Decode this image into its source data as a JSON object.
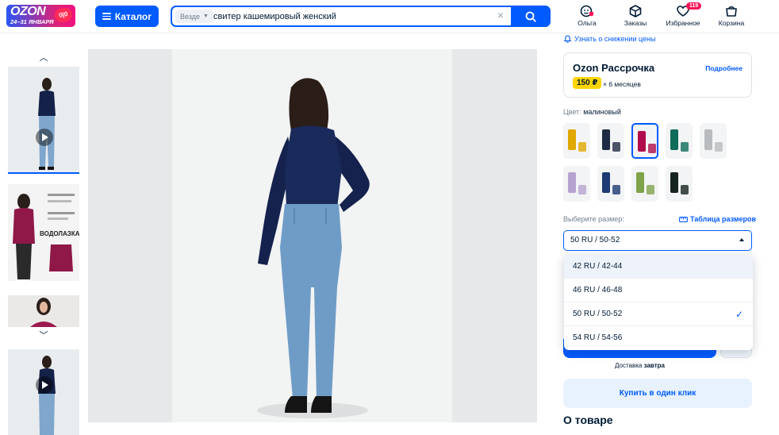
{
  "header": {
    "logo_text": "OZON",
    "logo_dates": "24–31 ЯНВАРЯ",
    "logo_badge": "0|0",
    "catalog_label": "Каталог",
    "search_scope": "Везде",
    "search_value": "свитер кашемировый женский",
    "nav": [
      {
        "label": "Ольга",
        "icon": "user-icon"
      },
      {
        "label": "Заказы",
        "icon": "box-icon"
      },
      {
        "label": "Избранное",
        "icon": "heart-icon",
        "badge": "119"
      },
      {
        "label": "Корзина",
        "icon": "cart-icon"
      }
    ]
  },
  "product": {
    "price_alert": "Узнать о снижении цены",
    "installment": {
      "title": "Ozon Рассрочка",
      "more": "Подробнее",
      "price": "150 ₽",
      "period": "× 6 месяцев"
    },
    "color_label": "Цвет:",
    "color_value": "малиновый",
    "colors": [
      "#e0a800",
      "#1f2a44",
      "#b00c4c",
      "#0f6b5a",
      "#b9bcbf",
      "#b7a2cf",
      "#1d3a72",
      "#7fa34a",
      "#16241f"
    ],
    "size_label": "Выберите размер:",
    "size_table": "Таблица размеров",
    "selected_size": "50 RU / 50-52",
    "size_options": [
      {
        "label": "42 RU / 42-44"
      },
      {
        "label": "46 RU / 46-48"
      },
      {
        "label": "50 RU / 50-52"
      },
      {
        "label": "54 RU / 54-56"
      }
    ],
    "check": "✓",
    "delivery_label": "Доставка",
    "delivery_day": "завтра",
    "one_click": "Купить в один клик",
    "about_title": "О товаре"
  },
  "gallery": {
    "thumb_up": "︿",
    "thumb_down": "﹀",
    "thumb_texts": [
      "ВОДОЛАЗКА"
    ]
  },
  "colors": {
    "accent": "#005bff",
    "text": "#001a34",
    "price_badge": "#ffd500",
    "badge": "#f91155"
  }
}
